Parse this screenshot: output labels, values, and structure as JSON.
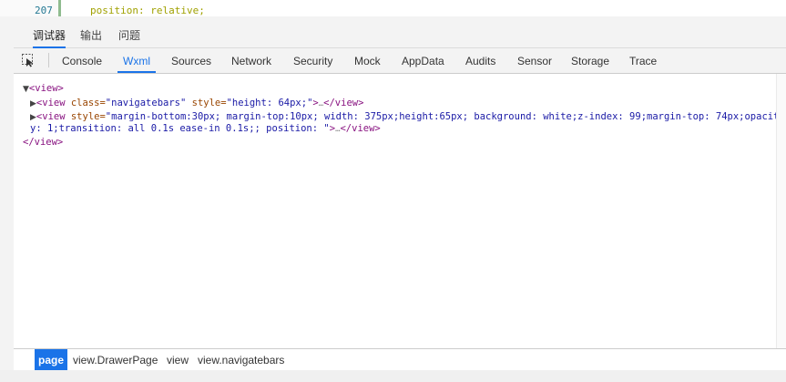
{
  "editor": {
    "line_number": "207",
    "code_line": "position: relative;"
  },
  "panel_tabs": [
    "调试器",
    "输出",
    "问题"
  ],
  "toolbar": {
    "tabs": [
      "Console",
      "Wxml",
      "Sources",
      "Network",
      "Security",
      "Mock",
      "AppData",
      "Audits",
      "Sensor",
      "Storage",
      "Trace"
    ],
    "active_tab": "Wxml",
    "inspect_icon": "inspect-pointer-icon"
  },
  "tree": {
    "root_open": "<view>",
    "root_close": "</view>",
    "child1": {
      "tag_open": "<view",
      "attr1_name": "class=",
      "attr1_value": "\"navigatebars\"",
      "attr2_name": "style=",
      "attr2_value": "\"height: 64px;\"",
      "tag_end": ">",
      "ellipsis": "…",
      "tag_close": "</view>"
    },
    "child2": {
      "tag_open": "<view",
      "attr1_name": "style=",
      "attr1_value": "\"margin-bottom:30px; margin-top:10px; width: 375px;height:65px; background: white;z-index: 99;margin-top: 74px;opacity: 1;transition: all 0.1s ease-in 0.1s;; position: \"",
      "tag_end": ">",
      "ellipsis": "…",
      "tag_close": "</view>"
    }
  },
  "breadcrumb": [
    "page",
    "view.DrawerPage",
    "view",
    "view.navigatebars"
  ],
  "colors": {
    "accent": "#1a73e8",
    "tag": "#881280",
    "attr": "#994500",
    "value": "#1a1aa6"
  }
}
